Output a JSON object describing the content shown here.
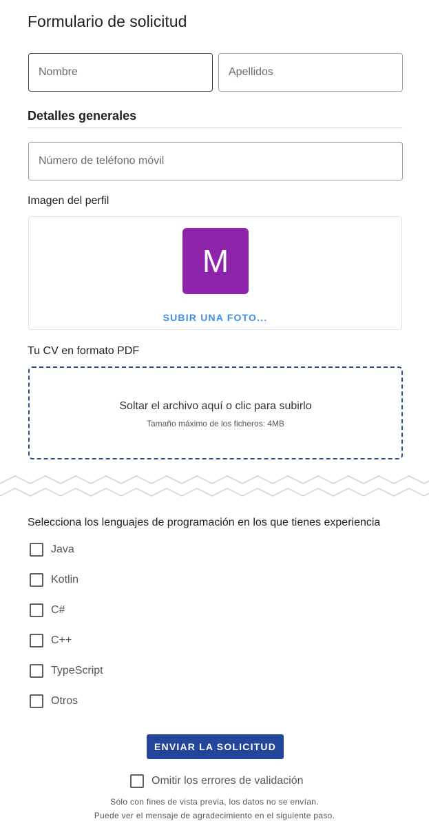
{
  "form": {
    "title": "Formulario de solicitud",
    "first_name_placeholder": "Nombre",
    "last_name_placeholder": "Apellidos",
    "general_heading": "Detalles generales",
    "phone_placeholder": "Número de teléfono móvil",
    "profile_image_label": "Imagen del perfil",
    "avatar_initial": "M",
    "avatar_color": "#8e24aa",
    "upload_photo_label": "SUBIR UNA FOTO...",
    "cv_label": "Tu CV en formato PDF",
    "dropzone_text": "Soltar el archivo aquí o clic para subirlo",
    "dropzone_hint": "Tamaño máximo de los ficheros: 4MB",
    "languages_question": "Selecciona los lenguajes de programación en los que tienes experiencia",
    "languages": [
      {
        "label": "Java",
        "checked": false
      },
      {
        "label": "Kotlin",
        "checked": false
      },
      {
        "label": "C#",
        "checked": false
      },
      {
        "label": "C++",
        "checked": false
      },
      {
        "label": "TypeScript",
        "checked": false
      },
      {
        "label": "Otros",
        "checked": false
      }
    ],
    "submit_label": "ENVIAR LA SOLICITUD",
    "skip_validation_label": "Omitir los errores de validación",
    "note_line1": "Sólo con fines de vista previa, los datos no se envían.",
    "note_line2": "Puede ver el mensaje de agradecimiento en el siguiente paso."
  },
  "colors": {
    "accent": "#23469a",
    "link": "#3d8ee6",
    "dropzone_border": "#2c4d8e"
  }
}
